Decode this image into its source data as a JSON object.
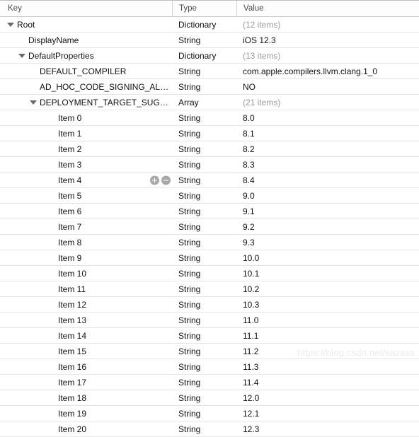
{
  "header": {
    "key_label": "Key",
    "type_label": "Type",
    "value_label": "Value"
  },
  "watermark": "https://blog.csdn.net/sazass",
  "colors": {
    "grid_line": "#e4e4e4",
    "header_text": "#4a4a4a",
    "row_text": "#111111",
    "muted_value": "#9a9a9a",
    "twisty": "#6b6b6b",
    "stepper_button": "#a8a8a8",
    "watermark": "#ebebeb"
  },
  "stepper": {
    "add_label": "+",
    "remove_label": "−"
  },
  "rows": [
    {
      "key": "Root",
      "type": "Dictionary",
      "value": "(12 items)",
      "muted": true,
      "indent": 0,
      "twisty": true,
      "stepper": false
    },
    {
      "key": "DisplayName",
      "type": "String",
      "value": "iOS 12.3",
      "muted": false,
      "indent": 1,
      "twisty": false,
      "stepper": false
    },
    {
      "key": "DefaultProperties",
      "type": "Dictionary",
      "value": "(13 items)",
      "muted": true,
      "indent": 1,
      "twisty": true,
      "stepper": false
    },
    {
      "key": "DEFAULT_COMPILER",
      "type": "String",
      "value": "com.apple.compilers.llvm.clang.1_0",
      "muted": false,
      "indent": 2,
      "twisty": false,
      "stepper": false
    },
    {
      "key": "AD_HOC_CODE_SIGNING_ALLOWED",
      "type": "String",
      "value": "NO",
      "muted": false,
      "indent": 2,
      "twisty": false,
      "stepper": false
    },
    {
      "key": "DEPLOYMENT_TARGET_SUGGESTE…",
      "type": "Array",
      "value": "(21 items)",
      "muted": true,
      "indent": 2,
      "twisty": true,
      "stepper": false
    },
    {
      "key": "Item 0",
      "type": "String",
      "value": "8.0",
      "muted": false,
      "indent": 3,
      "twisty": false,
      "stepper": false
    },
    {
      "key": "Item 1",
      "type": "String",
      "value": "8.1",
      "muted": false,
      "indent": 3,
      "twisty": false,
      "stepper": false
    },
    {
      "key": "Item 2",
      "type": "String",
      "value": "8.2",
      "muted": false,
      "indent": 3,
      "twisty": false,
      "stepper": false
    },
    {
      "key": "Item 3",
      "type": "String",
      "value": "8.3",
      "muted": false,
      "indent": 3,
      "twisty": false,
      "stepper": false
    },
    {
      "key": "Item 4",
      "type": "String",
      "value": "8.4",
      "muted": false,
      "indent": 3,
      "twisty": false,
      "stepper": true
    },
    {
      "key": "Item 5",
      "type": "String",
      "value": "9.0",
      "muted": false,
      "indent": 3,
      "twisty": false,
      "stepper": false
    },
    {
      "key": "Item 6",
      "type": "String",
      "value": "9.1",
      "muted": false,
      "indent": 3,
      "twisty": false,
      "stepper": false
    },
    {
      "key": "Item 7",
      "type": "String",
      "value": "9.2",
      "muted": false,
      "indent": 3,
      "twisty": false,
      "stepper": false
    },
    {
      "key": "Item 8",
      "type": "String",
      "value": "9.3",
      "muted": false,
      "indent": 3,
      "twisty": false,
      "stepper": false
    },
    {
      "key": "Item 9",
      "type": "String",
      "value": "10.0",
      "muted": false,
      "indent": 3,
      "twisty": false,
      "stepper": false
    },
    {
      "key": "Item 10",
      "type": "String",
      "value": "10.1",
      "muted": false,
      "indent": 3,
      "twisty": false,
      "stepper": false
    },
    {
      "key": "Item 11",
      "type": "String",
      "value": "10.2",
      "muted": false,
      "indent": 3,
      "twisty": false,
      "stepper": false
    },
    {
      "key": "Item 12",
      "type": "String",
      "value": "10.3",
      "muted": false,
      "indent": 3,
      "twisty": false,
      "stepper": false
    },
    {
      "key": "Item 13",
      "type": "String",
      "value": "11.0",
      "muted": false,
      "indent": 3,
      "twisty": false,
      "stepper": false
    },
    {
      "key": "Item 14",
      "type": "String",
      "value": "11.1",
      "muted": false,
      "indent": 3,
      "twisty": false,
      "stepper": false
    },
    {
      "key": "Item 15",
      "type": "String",
      "value": "11.2",
      "muted": false,
      "indent": 3,
      "twisty": false,
      "stepper": false
    },
    {
      "key": "Item 16",
      "type": "String",
      "value": "11.3",
      "muted": false,
      "indent": 3,
      "twisty": false,
      "stepper": false
    },
    {
      "key": "Item 17",
      "type": "String",
      "value": "11.4",
      "muted": false,
      "indent": 3,
      "twisty": false,
      "stepper": false
    },
    {
      "key": "Item 18",
      "type": "String",
      "value": "12.0",
      "muted": false,
      "indent": 3,
      "twisty": false,
      "stepper": false
    },
    {
      "key": "Item 19",
      "type": "String",
      "value": "12.1",
      "muted": false,
      "indent": 3,
      "twisty": false,
      "stepper": false
    },
    {
      "key": "Item 20",
      "type": "String",
      "value": "12.3",
      "muted": false,
      "indent": 3,
      "twisty": false,
      "stepper": false
    }
  ]
}
